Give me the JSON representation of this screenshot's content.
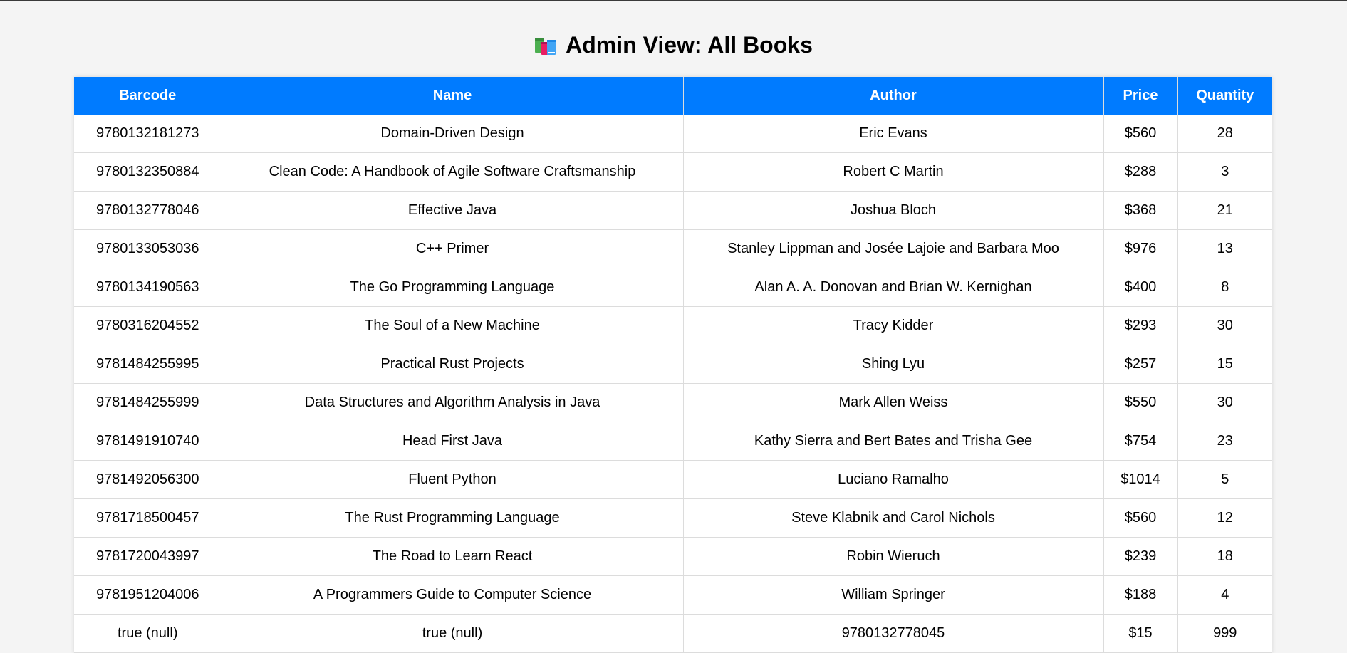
{
  "page": {
    "title": "Admin View: All Books",
    "title_icon": "books-icon"
  },
  "table": {
    "headers": {
      "barcode": "Barcode",
      "name": "Name",
      "author": "Author",
      "price": "Price",
      "quantity": "Quantity"
    },
    "rows": [
      {
        "barcode": "9780132181273",
        "name": "Domain-Driven Design",
        "author": "Eric Evans",
        "price": "$560",
        "quantity": "28"
      },
      {
        "barcode": "9780132350884",
        "name": "Clean Code: A Handbook of Agile Software Craftsmanship",
        "author": "Robert C Martin",
        "price": "$288",
        "quantity": "3"
      },
      {
        "barcode": "9780132778046",
        "name": "Effective Java",
        "author": "Joshua Bloch",
        "price": "$368",
        "quantity": "21"
      },
      {
        "barcode": "9780133053036",
        "name": "C++ Primer",
        "author": "Stanley Lippman and Josée Lajoie and Barbara Moo",
        "price": "$976",
        "quantity": "13"
      },
      {
        "barcode": "9780134190563",
        "name": "The Go Programming Language",
        "author": "Alan A. A. Donovan and Brian W. Kernighan",
        "price": "$400",
        "quantity": "8"
      },
      {
        "barcode": "9780316204552",
        "name": "The Soul of a New Machine",
        "author": "Tracy Kidder",
        "price": "$293",
        "quantity": "30"
      },
      {
        "barcode": "9781484255995",
        "name": "Practical Rust Projects",
        "author": "Shing Lyu",
        "price": "$257",
        "quantity": "15"
      },
      {
        "barcode": "9781484255999",
        "name": "Data Structures and Algorithm Analysis in Java",
        "author": "Mark Allen Weiss",
        "price": "$550",
        "quantity": "30"
      },
      {
        "barcode": "9781491910740",
        "name": "Head First Java",
        "author": "Kathy Sierra and Bert Bates and Trisha Gee",
        "price": "$754",
        "quantity": "23"
      },
      {
        "barcode": "9781492056300",
        "name": "Fluent Python",
        "author": "Luciano Ramalho",
        "price": "$1014",
        "quantity": "5"
      },
      {
        "barcode": "9781718500457",
        "name": "The Rust Programming Language",
        "author": "Steve Klabnik and Carol Nichols",
        "price": "$560",
        "quantity": "12"
      },
      {
        "barcode": "9781720043997",
        "name": "The Road to Learn React",
        "author": "Robin Wieruch",
        "price": "$239",
        "quantity": "18"
      },
      {
        "barcode": "9781951204006",
        "name": "A Programmers Guide to Computer Science",
        "author": "William Springer",
        "price": "$188",
        "quantity": "4"
      },
      {
        "barcode": "true (null)",
        "name": "true (null)",
        "author": "9780132778045",
        "price": "$15",
        "quantity": "999"
      }
    ]
  },
  "colors": {
    "header_bg": "#007bff",
    "page_bg": "#f4f4f4"
  }
}
